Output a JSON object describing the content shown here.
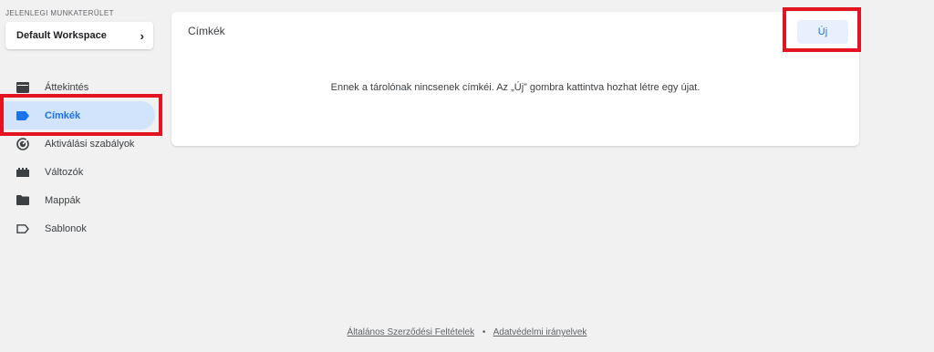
{
  "sidebar": {
    "workspace_heading": "JELENLEGI MUNKATERÜLET",
    "workspace_name": "Default Workspace",
    "items": [
      {
        "label": "Áttekintés",
        "icon": "overview-icon"
      },
      {
        "label": "Címkék",
        "icon": "tag-icon",
        "active": true
      },
      {
        "label": "Aktiválási szabályok",
        "icon": "trigger-icon"
      },
      {
        "label": "Változók",
        "icon": "variables-icon"
      },
      {
        "label": "Mappák",
        "icon": "folder-icon"
      },
      {
        "label": "Sablonok",
        "icon": "template-icon"
      }
    ]
  },
  "main": {
    "title": "Címkék",
    "new_button_label": "Új",
    "empty_message": "Ennek a tárolónak nincsenek címkéi. Az „Új” gombra kattintva hozhat létre egy újat."
  },
  "footer": {
    "terms_label": "Általános Szerződési Feltételek",
    "separator": "•",
    "privacy_label": "Adatvédelmi irányelvek"
  },
  "colors": {
    "accent": "#1a73e8",
    "active_bg": "#d2e3fc",
    "highlight": "#e3141f",
    "background": "#f1f1f1"
  }
}
